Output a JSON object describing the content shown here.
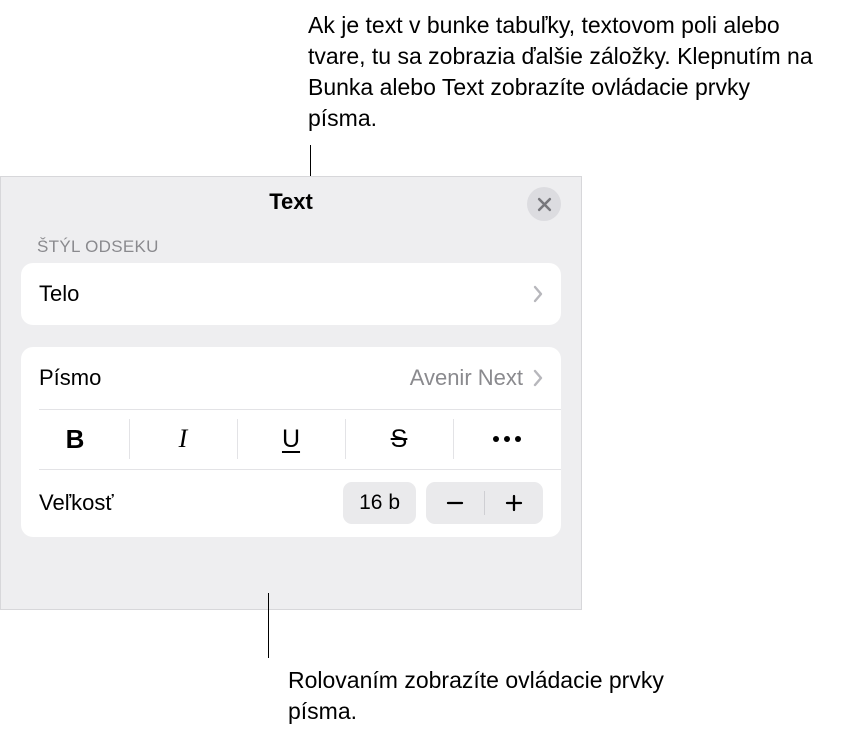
{
  "callouts": {
    "top": "Ak je text v bunke tabuľky, textovom poli alebo tvare, tu sa zobrazia ďalšie záložky. Klepnutím na Bunka alebo Text zobrazíte ovládacie prvky písma.",
    "bottom": "Rolovaním zobrazíte ovládacie prvky písma."
  },
  "panel": {
    "title": "Text",
    "section_label": "ŠTÝL ODSEKU",
    "paragraph_style": {
      "value": "Telo"
    },
    "font_row": {
      "label": "Písmo",
      "value": "Avenir Next"
    },
    "style_buttons": {
      "bold": "B",
      "italic": "I",
      "underline": "U",
      "strike": "S"
    },
    "size_row": {
      "label": "Veľkosť",
      "value": "16 b"
    }
  }
}
